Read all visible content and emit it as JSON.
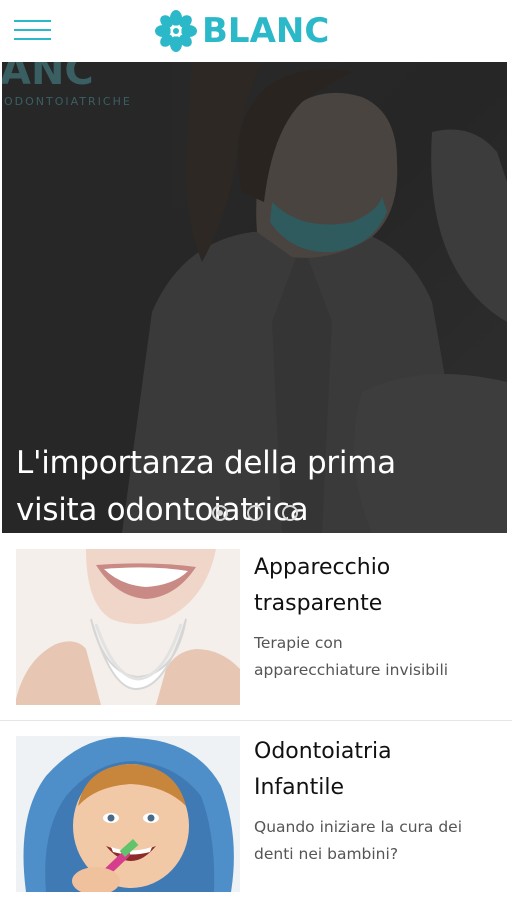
{
  "header": {
    "menu_icon": "hamburger-menu-icon",
    "logo_icon": "flower-logo-icon",
    "logo_text": "BLANC",
    "brand_color": "#2bb8c9"
  },
  "hero": {
    "title_line1": "L'importanza della prima",
    "title_line2": "visita odontoiatrica",
    "watermark_top": "ANC",
    "watermark_bottom": "ODONTOIATRICHE",
    "slides_total": 3,
    "active_slide": 1
  },
  "articles": [
    {
      "title_line1": "Apparecchio",
      "title_line2": "trasparente",
      "desc_line1": "Terapie con",
      "desc_line2": "apparecchiature invisibili"
    },
    {
      "title_line1": "Odontoiatria",
      "title_line2": "Infantile",
      "desc_line1": "Quando iniziare la cura dei",
      "desc_line2": "denti nei bambini?"
    }
  ]
}
